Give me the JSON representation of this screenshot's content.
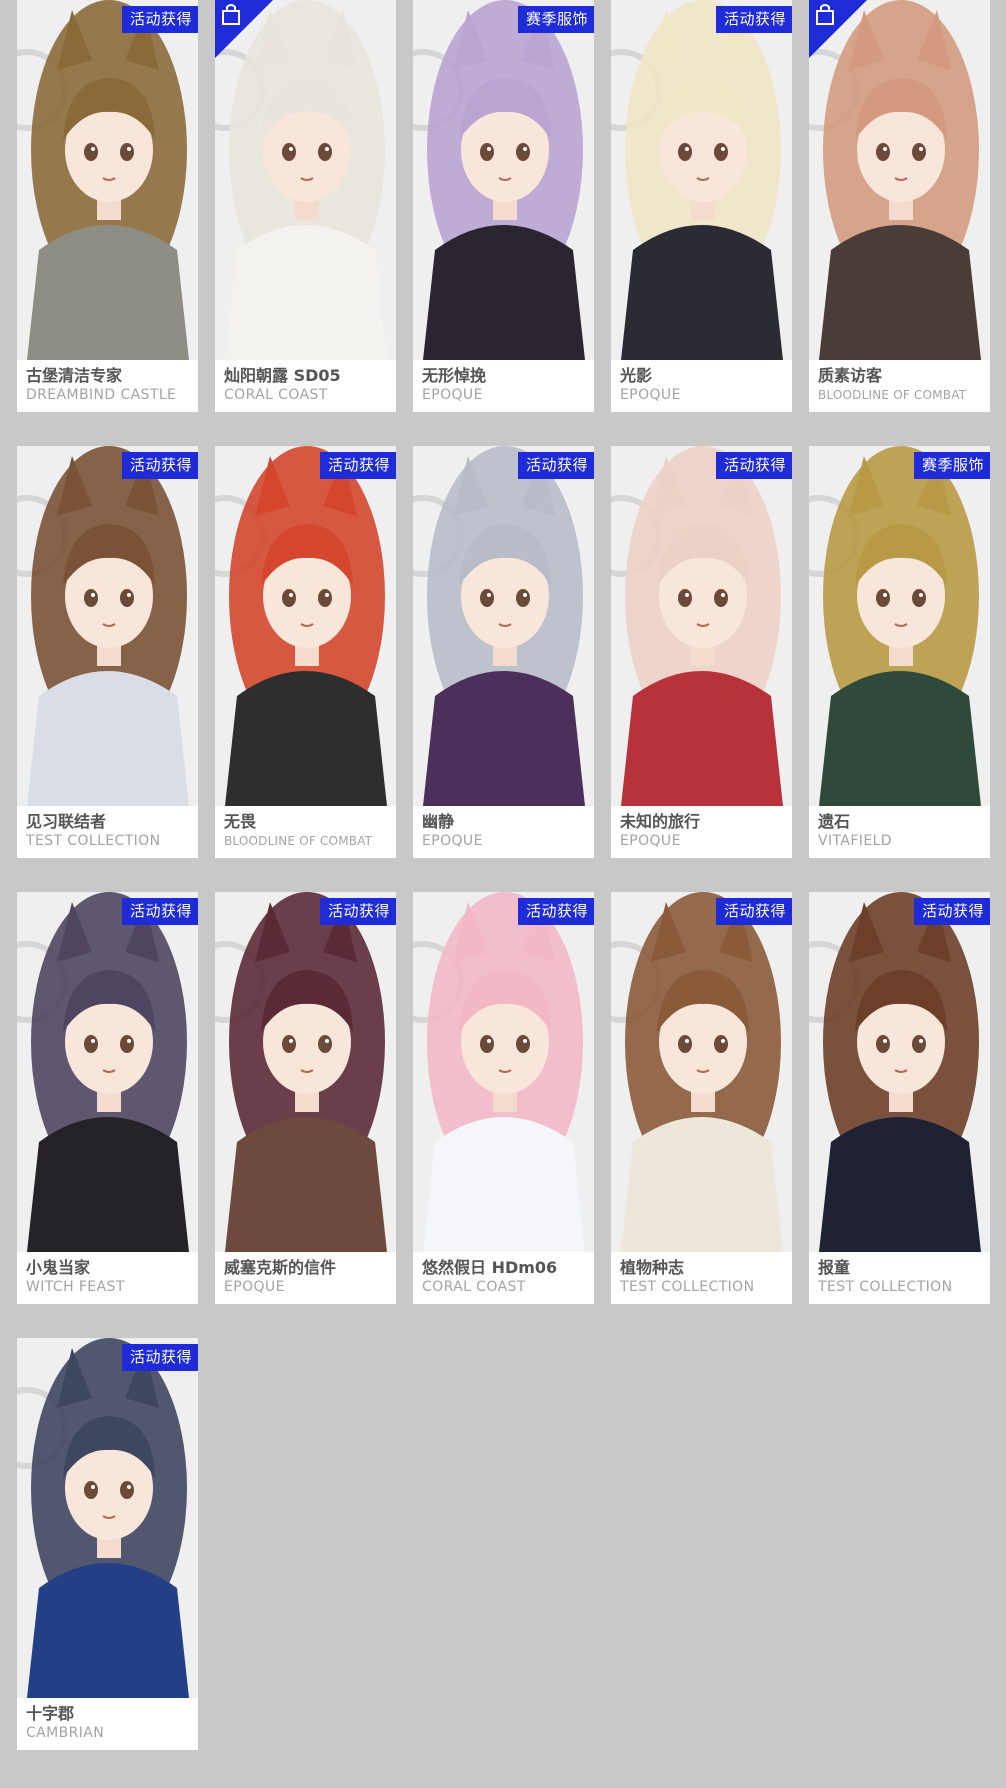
{
  "colors": {
    "page_background": "#c8c8c8",
    "card_background": "#ffffff",
    "badge_background": "#1f2bd6",
    "badge_text": "#ffffff",
    "name_text": "#555555",
    "series_text": "#a3a3a3"
  },
  "skins": [
    {
      "name": "古堡清洁专家",
      "series": "DREAMBIND CASTLE",
      "badge": "活动获得",
      "corner_icon": null,
      "hair": "#8b6a3a",
      "outfit": "#8e8d84"
    },
    {
      "name": "灿阳朝露 SD05",
      "series": "CORAL COAST",
      "badge": null,
      "corner_icon": "shop-bag-icon",
      "hair": "#e8e4dc",
      "outfit": "#f4f2ee"
    },
    {
      "name": "无形悼挽",
      "series": "EPOQUE",
      "badge": "赛季服饰",
      "corner_icon": null,
      "hair": "#b9a4d2",
      "outfit": "#2a2530"
    },
    {
      "name": "光影",
      "series": "EPOQUE",
      "badge": "活动获得",
      "corner_icon": null,
      "hair": "#efe6c5",
      "outfit": "#2b2b33"
    },
    {
      "name": "质素访客",
      "series": "BLOODLINE OF COMBAT",
      "badge": null,
      "corner_icon": "shop-bag-icon",
      "hair": "#d39a80",
      "outfit": "#4a3c36"
    },
    {
      "name": "见习联结者",
      "series": "TEST COLLECTION",
      "badge": "活动获得",
      "corner_icon": null,
      "hair": "#7a5236",
      "outfit": "#d8dde6"
    },
    {
      "name": "无畏",
      "series": "BLOODLINE OF COMBAT",
      "badge": "活动获得",
      "corner_icon": null,
      "hair": "#d4472e",
      "outfit": "#2e2e2e"
    },
    {
      "name": "幽静",
      "series": "EPOQUE",
      "badge": "活动获得",
      "corner_icon": null,
      "hair": "#b7bcc8",
      "outfit": "#4c2f5a"
    },
    {
      "name": "未知的旅行",
      "series": "EPOQUE",
      "badge": "活动获得",
      "corner_icon": null,
      "hair": "#ecd2c6",
      "outfit": "#b8323b"
    },
    {
      "name": "遗石",
      "series": "VITAFIELD",
      "badge": "赛季服饰",
      "corner_icon": null,
      "hair": "#b89a46",
      "outfit": "#2f4a3a"
    },
    {
      "name": "小鬼当家",
      "series": "WITCH FEAST",
      "badge": "活动获得",
      "corner_icon": null,
      "hair": "#4f4560",
      "outfit": "#262328"
    },
    {
      "name": "威塞克斯的信件",
      "series": "EPOQUE",
      "badge": "活动获得",
      "corner_icon": null,
      "hair": "#5b2a37",
      "outfit": "#6d4a3d"
    },
    {
      "name": "悠然假日 HDm06",
      "series": "CORAL COAST",
      "badge": "活动获得",
      "corner_icon": null,
      "hair": "#f2b8c6",
      "outfit": "#f4f6fa"
    },
    {
      "name": "植物种志",
      "series": "TEST COLLECTION",
      "badge": "活动获得",
      "corner_icon": null,
      "hair": "#8a5a3a",
      "outfit": "#ece7da"
    },
    {
      "name": "报童",
      "series": "TEST COLLECTION",
      "badge": "活动获得",
      "corner_icon": null,
      "hair": "#6b3f28",
      "outfit": "#1f2233"
    },
    {
      "name": "十字郡",
      "series": "CAMBRIAN",
      "badge": "活动获得",
      "corner_icon": null,
      "hair": "#3f4660",
      "outfit": "#233f86"
    }
  ]
}
